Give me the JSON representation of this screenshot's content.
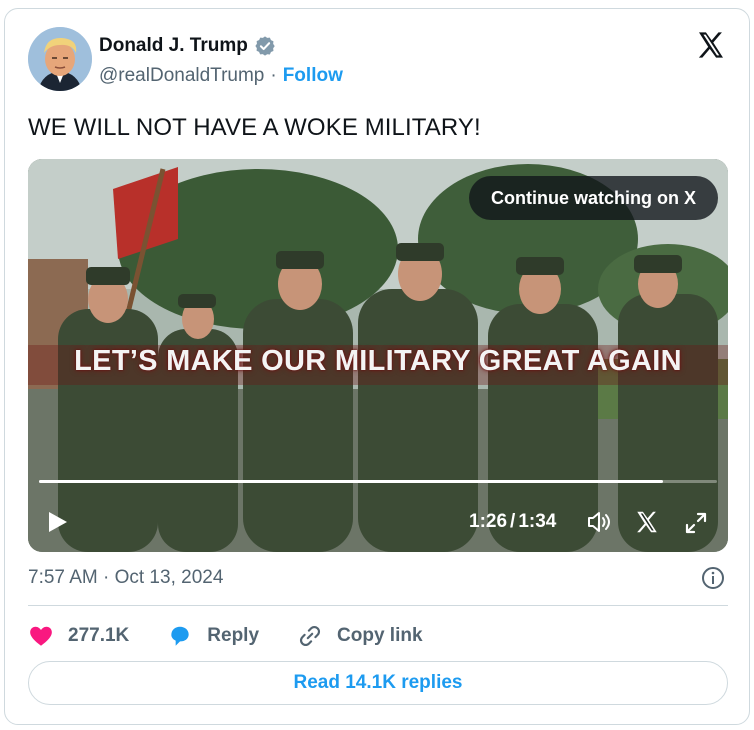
{
  "author": {
    "display_name": "Donald J. Trump",
    "handle": "@realDonaldTrump",
    "separator": "·",
    "follow_label": "Follow",
    "verified": true
  },
  "tweet": {
    "text": "WE WILL NOT HAVE A WOKE MILITARY!",
    "timestamp": "7:57 AM · Oct 13, 2024"
  },
  "video": {
    "continue_label": "Continue watching on X",
    "caption": "LET’S MAKE OUR MILITARY GREAT AGAIN",
    "current_time": "1:26",
    "time_separator": "/",
    "duration": "1:34",
    "progress_fraction": 0.92
  },
  "actions": {
    "likes_count": "277.1K",
    "reply_label": "Reply",
    "copy_link_label": "Copy link"
  },
  "read_replies_label": "Read 14.1K replies",
  "colors": {
    "accent": "#1d9bf0",
    "like": "#f91880",
    "text_secondary": "#536471",
    "border": "#cfd9de"
  },
  "icons": [
    "verified-badge-icon",
    "x-logo-icon",
    "play-icon",
    "volume-icon",
    "x-logo-icon",
    "fullscreen-icon",
    "info-icon",
    "heart-icon",
    "reply-bubble-icon",
    "link-icon"
  ]
}
